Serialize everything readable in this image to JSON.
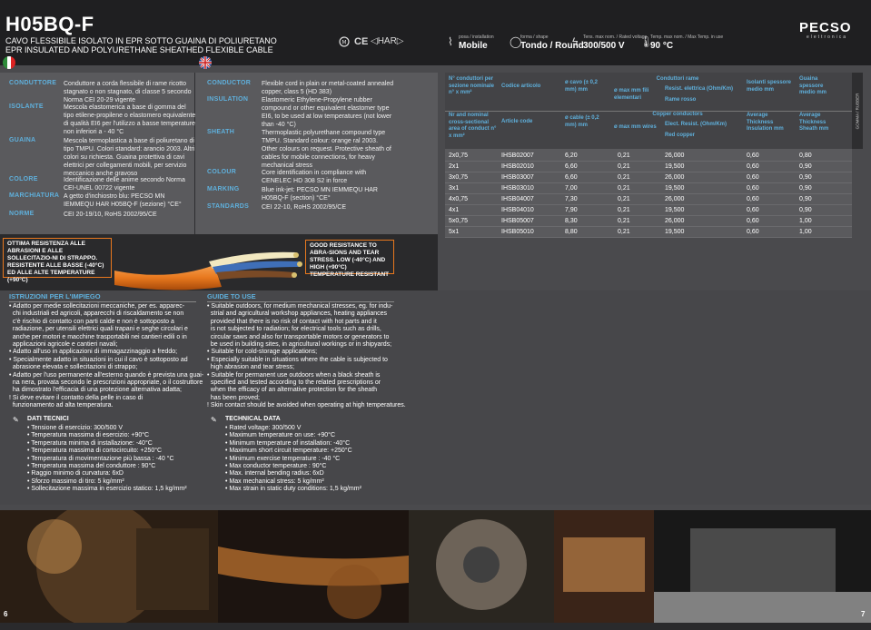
{
  "header": {
    "title": "H05BQ-F",
    "subtitle_it": "CAVO FLESSIBILE ISOLATO IN EPR SOTTO GUAINA DI POLIURETANO",
    "subtitle_en": "EPR INSULATED AND POLYURETHANE SHEATHED FLEXIBLE CABLE",
    "cert_ce": "CE",
    "cert_har": "◁HAR▷",
    "posa_label": "posa / installation",
    "posa_value": "Mobile",
    "forma_label": "forma / shape",
    "forma_value": "Tondo / Round",
    "tens_label": "Tens. max nom. / Rated voltage",
    "tens_value": "300/500 V",
    "temp_label": "Temp. max nom. / Max Temp. in use",
    "temp_value": "90 °C",
    "logo": "PECSO",
    "logo_sub": "elettronica"
  },
  "it_specs": [
    {
      "label": "CONDUTTORE",
      "text": "Conduttore a corda flessibile di rame ricotto stagnato o non stagnato, di classe 5 secondo Norma CEI 20-29 vigente"
    },
    {
      "label": "ISOLANTE",
      "text": "Mescola elastomerica a base di gomma del tipo etilene-propilene o elastomero equivalente di qualità EI6 per l'utilizzo a basse temperature non inferiori a - 40 °C"
    },
    {
      "label": "GUAINA",
      "text": "Mescola termoplastica a base di poliuretano di tipo TMPU. Colori standard: arancio 2003. Altri colori su richiesta. Guaina protettiva di cavi elettrici per collegamenti mobili, per servizio meccanico anche gravoso"
    },
    {
      "label": "COLORE",
      "text": "Identificazione delle anime secondo Norma CEI-UNEL 00722 vigente"
    },
    {
      "label": "MARCHIATURA",
      "text": "A getto d'inchiostro blu: PECSO MN IEMMEQU HAR H05BQ-F (sezione) °CE°"
    },
    {
      "label": "NORME",
      "text": "CEI 20-19/10, RoHS 2002/95/CE"
    }
  ],
  "en_specs": [
    {
      "label": "CONDUCTOR",
      "text": "Flexible cord in plain or metal-coated annealed copper, class 5 (HD 383)"
    },
    {
      "label": "INSULATION",
      "text": "Elastomeric Ethylene-Propylene rubber compound or other equivalent elastomer type EI6, to be used at low temperatures (not lower than -40 °C)"
    },
    {
      "label": "SHEATH",
      "text": "Thermoplastic polyurethane compound type TMPU. Standard colour: orange ral 2003. Other colours on request. Protective sheath of cables for mobile connections, for heavy mechanical stress"
    },
    {
      "label": "COLOUR",
      "text": "Core identification in compliance with CENELEC HD 308 S2 in force"
    },
    {
      "label": "MARKING",
      "text": "Blue ink-jet: PECSO MN IEMMEQU HAR H05BQ-F (section) °CE°"
    },
    {
      "label": "STANDARDS",
      "text": "CEI 22-10, RoHS 2002/95/CE"
    }
  ],
  "highlight_it": "OTTIMA RESISTENZA ALLE ABRASIONI E ALLE SOLLECITAZIO-NI DI STRAPPO. RESISTENTE ALLE BASSE (-40°C) ED ALLE ALTE TEMPERATURE (+90°C)",
  "highlight_en": "GOOD RESISTANCE TO ABRA-SIONS AND TEAR STRESS. LOW (-40°C) AND HIGH (+90°C) TEMPERATURE RESISTANT",
  "table": {
    "headers_it": {
      "col1": "N° conduttori per sezione nominale n° x mm²",
      "col2": "Codice articolo",
      "col3": "ø cavo (± 0,2 mm) mm",
      "group": "Conduttori rame",
      "col4": "ø max mm fili elementari",
      "col5": "Resist. elettrica (Ohm/Km)",
      "col5b": "Rame rosso",
      "col6": "Isolanti spessore medio mm",
      "col7": "Guaina spessore medio mm"
    },
    "headers_en": {
      "col1": "Nr and nominal cross-sectional area of conduct n° x mm²",
      "col2": "Article code",
      "col3": "ø cable (± 0,2 mm) mm",
      "group": "Copper conductors",
      "col4": "ø max mm wires",
      "col5": "Elect. Resist. (Ohm/Km)",
      "col5b": "Red copper",
      "col6": "Average Thickness Insulation mm",
      "col7": "Average Thickness Sheath mm"
    },
    "side_label": "GOMMA / RUBBER",
    "rows": [
      [
        "2x0,75",
        "IHSB02007",
        "6,20",
        "0,21",
        "26,000",
        "0,60",
        "0,80"
      ],
      [
        "2x1",
        "IHSB02010",
        "6,60",
        "0,21",
        "19,500",
        "0,60",
        "0,90"
      ],
      [
        "3x0,75",
        "IHSB03007",
        "6,60",
        "0,21",
        "26,000",
        "0,60",
        "0,90"
      ],
      [
        "3x1",
        "IHSB03010",
        "7,00",
        "0,21",
        "19,500",
        "0,60",
        "0,90"
      ],
      [
        "4x0,75",
        "IHSB04007",
        "7,30",
        "0,21",
        "26,000",
        "0,60",
        "0,90"
      ],
      [
        "4x1",
        "IHSB04010",
        "7,90",
        "0,21",
        "19,500",
        "0,60",
        "0,90"
      ],
      [
        "5x0,75",
        "IHSB05007",
        "8,30",
        "0,21",
        "26,000",
        "0,60",
        "1,00"
      ],
      [
        "5x1",
        "IHSB05010",
        "8,80",
        "0,21",
        "19,500",
        "0,60",
        "1,00"
      ]
    ]
  },
  "istruzioni": {
    "title": "ISTRUZIONI PER L'IMPIEGO",
    "items": [
      "• Adatto per medie sollecitazioni meccaniche, per es. apparec-",
      "  chi industriali ed agricoli, apparecchi di riscaldamento se non",
      "  c'è rischio di contatto con parti calde e non è sottoposto a",
      "  radiazione, per utensili elettrici quali trapani e seghe circolari e",
      "  anche per motori e macchine trasportabili nei cantieri edili o in",
      "  applicazioni agricole e cantieri navali;",
      "• Adatto all'uso in applicazioni di immagazzinaggio a freddo;",
      "• Specialmente adatto in situazioni in cui il cavo è sottoposto ad",
      "  abrasione elevata e sollecitazioni di strappo;",
      "• Adatto per l'uso permanente all'esterno quando è prevista una guai-",
      "  na nera, provata secondo le prescrizioni appropriate, o il costruttore",
      "  ha dimostrato l'efficacia di una protezione alternativa adatta;",
      "! Si deve evitare il contatto della pelle in caso di",
      "  funzionamento ad alta temperatura."
    ]
  },
  "guide": {
    "title": "GUIDE TO USE",
    "items": [
      "• Suitable outdoors, for medium mechanical stresses, eg. for indu-",
      "  strial and agricultural workshop appliances, heating appliances",
      "  provided that there is no risk of contact with hot parts and it",
      "  is not subjected to radiation; for electrical tools such as drills,",
      "  circular saws and also for transportable motors or generators to",
      "  be used in building sites, in agricultural workings or in shipyards;",
      "• Suitable for cold-storage applications;",
      "• Especially suitable in situations where the cable is subjected to",
      "  high abrasion and tear stress;",
      "• Suitable for permanent use outdoors when a black sheath is",
      "  specified and tested according to the related prescriptions or",
      "  when the efficacy of an alternative protection for the sheath",
      "  has been proved;",
      "! Skin contact should be avoided when operating at high temperatures."
    ]
  },
  "dati_tecnici": {
    "title": "DATI TECNICI",
    "items": [
      "• Tensione di esercizio: 300/500 V",
      "• Temperatura massima di esercizio: +90°C",
      "• Temperatura minima di installazione: -40°C",
      "• Temperatura massima di cortocircuito: +250°C",
      "• Temperatura di movimentazione più bassa : -40 °C",
      "• Temperatura massima del conduttore : 90°C",
      "• Raggio minimo di curvatura: 6xD",
      "• Sforzo massimo di tiro: 5 kg/mm²",
      "• Sollecitazione massima in esercizio statico: 1,5 kg/mm²"
    ]
  },
  "technical_data": {
    "title": "TECHNICAL DATA",
    "items": [
      "• Rated voltage: 300/500 V",
      "• Maximum temperature on use: +90°C",
      "• Minimum temperature of installation: -40°C",
      "• Maximum short circuit temperature: +250°C",
      "• Minimum exercise temperature : -40 °C",
      "• Max conductor temperature : 90°C",
      "• Max. internal bending radius: 6xD",
      "• Max mechanical stress: 5 kg/mm²",
      "• Max strain in static duty conditions: 1,5 kg/mm²"
    ]
  },
  "page_left": "6",
  "page_right": "7",
  "colors": {
    "accent": "#5fb0dc",
    "orange": "#e8781e",
    "bg": "#4a4a4d"
  }
}
